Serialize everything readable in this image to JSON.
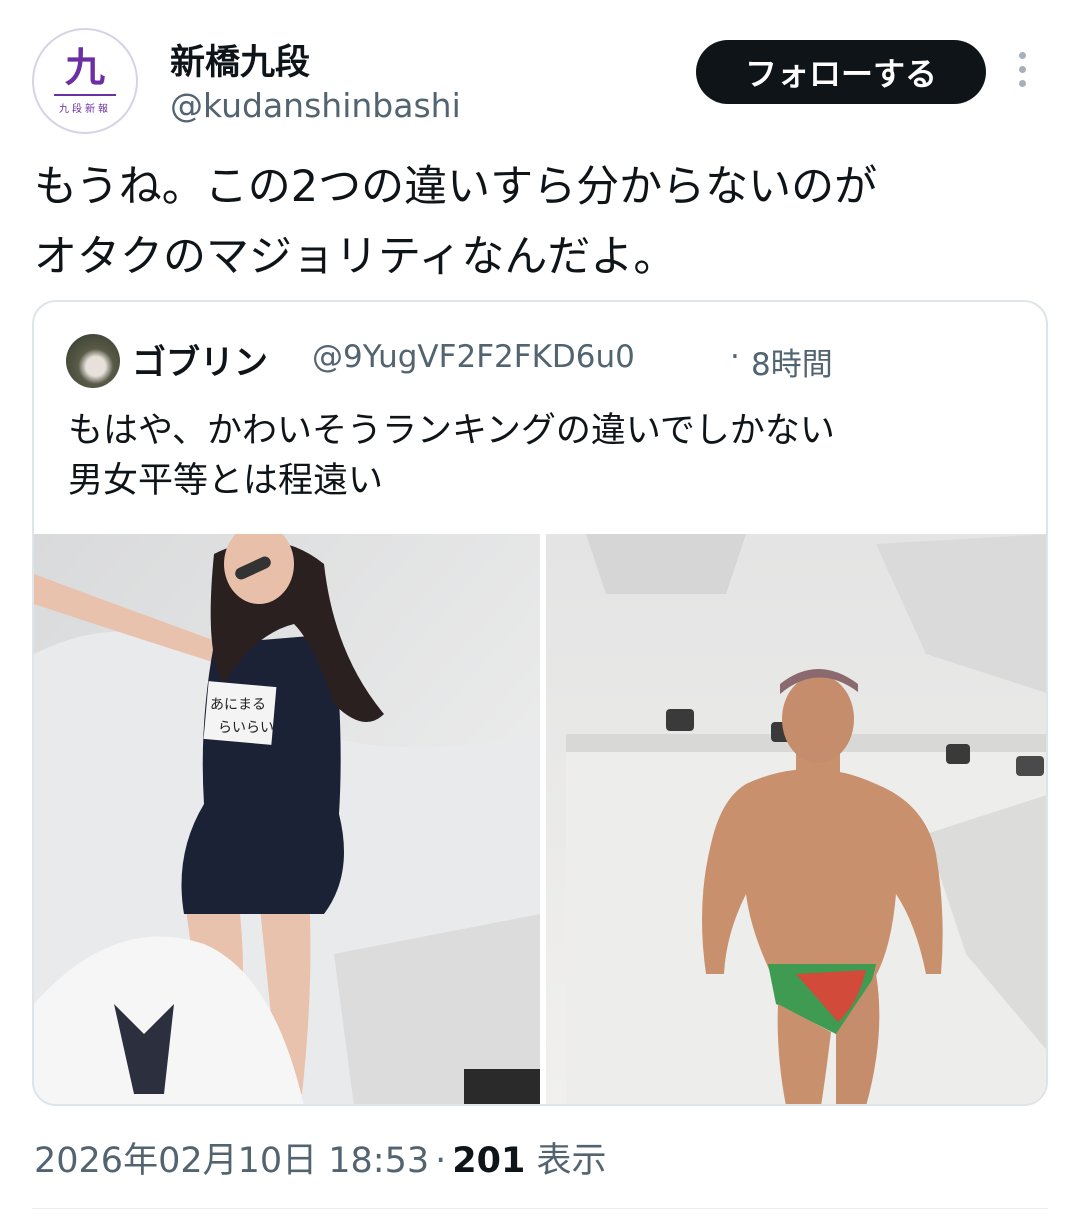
{
  "author": {
    "display_name": "新橋九段",
    "handle": "@kudanshinbashi",
    "avatar": {
      "kanji": "九",
      "subtitle": "九段新報"
    }
  },
  "follow_button": {
    "label": "フォローする"
  },
  "more_icon": "more-vertical-icon",
  "tweet": {
    "text": "もうね。この2つの違いすら分からないのが\nオタクのマジョリティなんだよ。"
  },
  "quoted_tweet": {
    "author_name": "ゴブリン",
    "author_handle": "@9YugVF2F2FKD6u0",
    "separator": "·",
    "time_ago": "8時間",
    "text": "もはや、かわいそうランキングの違いでしかない\n男女平等とは程遠い",
    "media": [
      {
        "name": "photo-left",
        "sign_text_line1": "あにまる",
        "sign_text_line2": "らいらい"
      },
      {
        "name": "photo-right"
      }
    ]
  },
  "meta": {
    "timestamp": "2026年02月10日 18:53",
    "separator": "·",
    "view_count": "201",
    "view_label": "表示"
  },
  "colors": {
    "text": "#0f1419",
    "secondary": "#536471",
    "border": "#dfe4e8",
    "button_bg": "#0f1419"
  }
}
